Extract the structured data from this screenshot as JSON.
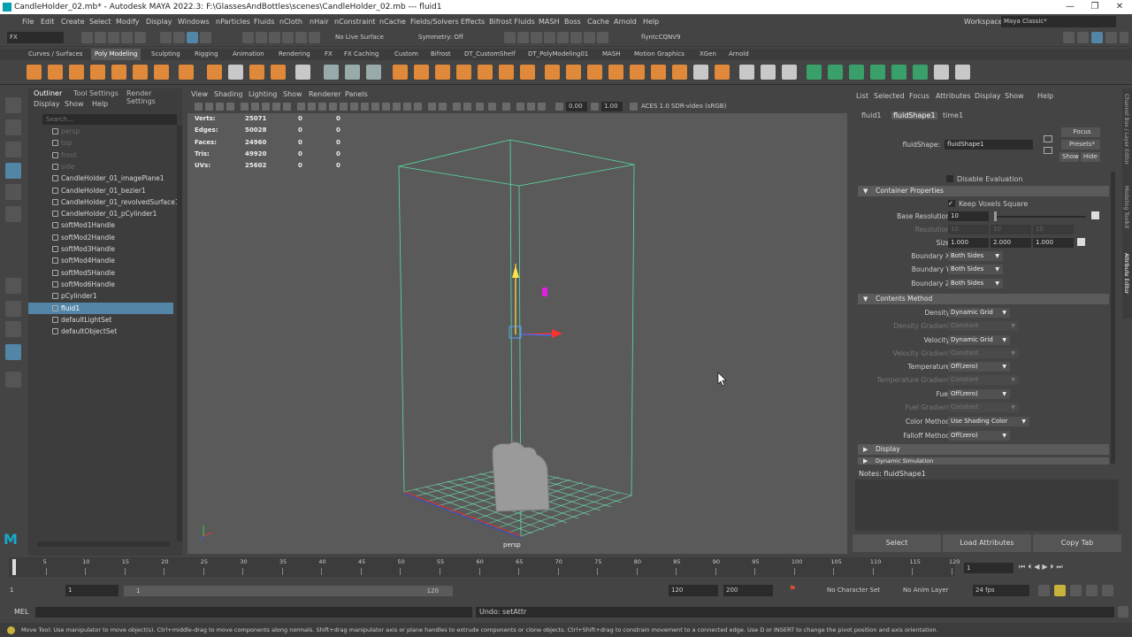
{
  "window": {
    "title": "CandleHolder_02.mb* - Autodesk MAYA 2022.3: F:\\GlassesAndBottles\\scenes\\CandleHolder_02.mb   ---   fluid1",
    "min": "—",
    "max": "❐",
    "close": "✕"
  },
  "menu": [
    "File",
    "Edit",
    "Create",
    "Select",
    "Modify",
    "Display",
    "Windows",
    "nParticles",
    "Fluids",
    "nCloth",
    "nHair",
    "nConstraint",
    "nCache",
    "Fields/Solvers",
    "Effects",
    "Bifrost Fluids",
    "MASH",
    "Boss",
    "Cache",
    "Arnold",
    "Help"
  ],
  "workspace": {
    "label": "Workspace:",
    "value": "Maya Classic*"
  },
  "status": {
    "menuset": "FX",
    "live_surface": "No Live Surface",
    "symmetry": "Symmetry: Off",
    "user": "flyntcCQNV9"
  },
  "shelf_tabs": [
    "Curves / Surfaces",
    "Poly Modeling",
    "Sculpting",
    "Rigging",
    "Animation",
    "Rendering",
    "FX",
    "FX Caching",
    "Custom",
    "Bifrost",
    "DT_CustomShelf",
    "DT_PolyModeling01",
    "MASH",
    "Motion Graphics",
    "XGen",
    "Arnold"
  ],
  "outliner": {
    "tabs": [
      "Outliner",
      "Tool Settings",
      "Render Settings"
    ],
    "menu": [
      "Display",
      "Show",
      "Help"
    ],
    "search_placeholder": "Search...",
    "items": [
      {
        "label": "persp",
        "dim": true
      },
      {
        "label": "top",
        "dim": true
      },
      {
        "label": "front",
        "dim": true
      },
      {
        "label": "side",
        "dim": true
      },
      {
        "label": "CandleHolder_01_imagePlane1"
      },
      {
        "label": "CandleHolder_01_bezier1"
      },
      {
        "label": "CandleHolder_01_revolvedSurface1"
      },
      {
        "label": "CandleHolder_01_pCylinder1"
      },
      {
        "label": "softMod1Handle"
      },
      {
        "label": "softMod2Handle"
      },
      {
        "label": "softMod3Handle"
      },
      {
        "label": "softMod4Handle"
      },
      {
        "label": "softMod5Handle"
      },
      {
        "label": "softMod6Handle"
      },
      {
        "label": "pCylinder1"
      },
      {
        "label": "fluid1",
        "selected": true
      },
      {
        "label": "defaultLightSet"
      },
      {
        "label": "defaultObjectSet"
      }
    ]
  },
  "viewport": {
    "menu": [
      "View",
      "Shading",
      "Lighting",
      "Show",
      "Renderer",
      "Panels"
    ],
    "exposure": "0.00",
    "gamma": "1.00",
    "colorspace": "ACES 1.0 SDR-video (sRGB)",
    "hud": [
      {
        "label": "Verts:",
        "a": "25071",
        "b": "0",
        "c": "0"
      },
      {
        "label": "Edges:",
        "a": "50028",
        "b": "0",
        "c": "0"
      },
      {
        "label": "Faces:",
        "a": "24960",
        "b": "0",
        "c": "0"
      },
      {
        "label": "Tris:",
        "a": "49920",
        "b": "0",
        "c": "0"
      },
      {
        "label": "UVs:",
        "a": "25602",
        "b": "0",
        "c": "0"
      }
    ],
    "camera": "persp"
  },
  "attr": {
    "menu": [
      "List",
      "Selected",
      "Focus",
      "Attributes",
      "Display",
      "Show",
      "Help"
    ],
    "tabs": [
      "fluid1",
      "fluidShape1",
      "time1"
    ],
    "node_label": "fluidShape:",
    "node_value": "fluidShape1",
    "focus": "Focus",
    "presets": "Presets*",
    "show": "Show",
    "hide": "Hide",
    "disable_eval": "Disable Evaluation",
    "container": "Container Properties",
    "keep_voxels": "Keep Voxels Square",
    "base_res_label": "Base Resolution",
    "base_res": "10",
    "resolution_label": "Resolution",
    "res": [
      "10",
      "10",
      "10"
    ],
    "size_label": "Size",
    "size": [
      "1.000",
      "2.000",
      "1.000"
    ],
    "boundary": [
      {
        "label": "Boundary X",
        "value": "Both Sides"
      },
      {
        "label": "Boundary Y",
        "value": "Both Sides"
      },
      {
        "label": "Boundary Z",
        "value": "Both Sides"
      }
    ],
    "contents": "Contents Method",
    "methods": [
      {
        "label": "Density",
        "value": "Dynamic Grid"
      },
      {
        "label": "Density Gradient",
        "value": "Constant",
        "dim": true
      },
      {
        "label": "Velocity",
        "value": "Dynamic Grid"
      },
      {
        "label": "Velocity Gradient",
        "value": "Constant",
        "dim": true
      },
      {
        "label": "Temperature",
        "value": "Off(zero)"
      },
      {
        "label": "Temperature Gradient",
        "value": "Constant",
        "dim": true
      },
      {
        "label": "Fuel",
        "value": "Off(zero)"
      },
      {
        "label": "Fuel Gradient",
        "value": "Constant",
        "dim": true
      },
      {
        "label": "Color Method",
        "value": "Use Shading Color"
      },
      {
        "label": "Falloff Method",
        "value": "Off(zero)"
      }
    ],
    "display": "Display",
    "dynsim": "Dynamic Simulation",
    "notes": "Notes:  fluidShape1",
    "buttons": [
      "Select",
      "Load Attributes",
      "Copy Tab"
    ]
  },
  "side_tabs": [
    "Channel Box / Layer Editor",
    "Modeling Toolkit",
    "Attribute Editor"
  ],
  "timeline": {
    "ticks": [
      "1",
      "5",
      "10",
      "15",
      "20",
      "25",
      "30",
      "35",
      "40",
      "45",
      "50",
      "55",
      "60",
      "65",
      "70",
      "75",
      "80",
      "85",
      "90",
      "95",
      "100",
      "105",
      "110",
      "115",
      "120"
    ],
    "current": "1"
  },
  "range": {
    "start": "1",
    "start2": "1",
    "slider_start": "1",
    "slider_end": "120",
    "end": "120",
    "end2": "200",
    "charset": "No Character Set",
    "animlayer": "No Anim Layer",
    "fps": "24 fps"
  },
  "cmd": {
    "lang": "MEL",
    "result": "Undo: setAttr"
  },
  "help": "Move Tool: Use manipulator to move object(s). Ctrl+middle-drag to move components along normals. Shift+drag manipulator axis or plane handles to extrude components or clone objects. Ctrl+Shift+drag to constrain movement to a connected edge. Use D or INSERT to change the pivot position and axis orientation."
}
